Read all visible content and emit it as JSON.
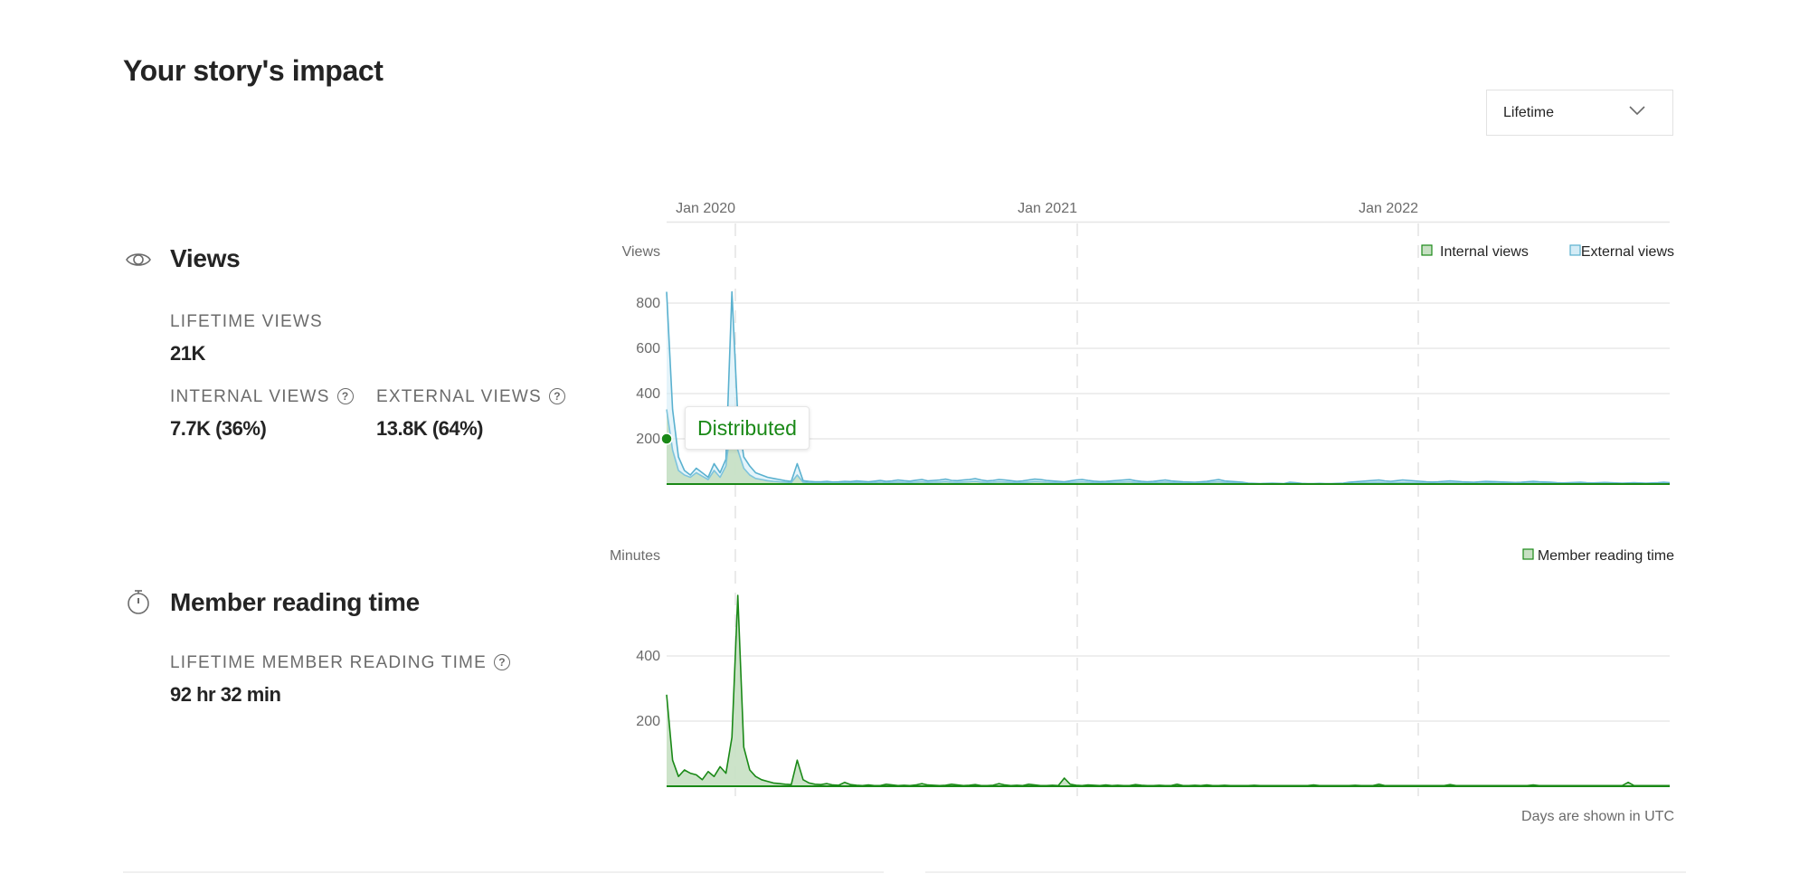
{
  "page": {
    "title": "Your story's impact",
    "period_dropdown": {
      "selected": "Lifetime"
    }
  },
  "views_section": {
    "title": "Views",
    "icon": "eye-icon",
    "lifetime_label": "Lifetime views",
    "lifetime_value": "21K",
    "internal_label": "Internal views",
    "internal_value": "7.7K (36%)",
    "external_label": "External views",
    "external_value": "13.8K (64%)",
    "help_glyph": "?"
  },
  "reading_section": {
    "title": "Member reading time",
    "icon": "stopwatch-icon",
    "lifetime_label": "Lifetime member reading time",
    "lifetime_value": "92 hr 32 min",
    "help_glyph": "?"
  },
  "tooltip": {
    "text": "Distributed"
  },
  "footnote": "Days are shown in UTC",
  "colors": {
    "internal": "#1a8917",
    "internal_fill": "#c7e0c3",
    "external": "#5ab1cf",
    "external_fill": "#d4ecf6",
    "grid": "#e8e8e8",
    "text_muted": "#6b6b6b"
  },
  "chart_data": [
    {
      "type": "area",
      "title": "Views",
      "ylabel": "Views",
      "x_tick_labels": [
        "Jan 2020",
        "Jan 2021",
        "Jan 2022"
      ],
      "x_range": [
        "Oct 2019",
        "Oct 2022"
      ],
      "yticks": [
        200,
        400,
        600,
        800
      ],
      "ylim": [
        0,
        860
      ],
      "grid": true,
      "legend": [
        "Internal views",
        "External views"
      ],
      "legend_position": "top-right",
      "annotation": {
        "label": "Distributed",
        "x_index": 0,
        "y": 200
      },
      "series": [
        {
          "name": "External views",
          "values": [
            850,
            330,
            120,
            60,
            40,
            70,
            50,
            30,
            90,
            50,
            110,
            850,
            300,
            120,
            80,
            50,
            40,
            30,
            25,
            20,
            15,
            12,
            90,
            15,
            12,
            10,
            10,
            12,
            9,
            10,
            12,
            11,
            14,
            12,
            10,
            13,
            16,
            12,
            14,
            18,
            15,
            13,
            17,
            20,
            14,
            16,
            18,
            22,
            16,
            15,
            18,
            20,
            24,
            18,
            14,
            16,
            20,
            18,
            15,
            12,
            14,
            18,
            22,
            20,
            16,
            14,
            12,
            10,
            14,
            18,
            20,
            16,
            13,
            11,
            12,
            14,
            16,
            18,
            20,
            15,
            12,
            10,
            12,
            15,
            18,
            14,
            12,
            10,
            9,
            8,
            10,
            12,
            16,
            20,
            14,
            12,
            10,
            8,
            4,
            3,
            2,
            3,
            4,
            3,
            2,
            8,
            6,
            3,
            2,
            2,
            3,
            2,
            2,
            3,
            4,
            8,
            10,
            12,
            14,
            16,
            18,
            14,
            12,
            15,
            18,
            16,
            14,
            12,
            10,
            9,
            10,
            12,
            14,
            12,
            10,
            9,
            8,
            10,
            12,
            11,
            10,
            9,
            8,
            7,
            8,
            10,
            12,
            10,
            9,
            8,
            6,
            5,
            6,
            7,
            8,
            6,
            5,
            6,
            7,
            6,
            5,
            4,
            5,
            6,
            5,
            4,
            5,
            6,
            8,
            6
          ]
        },
        {
          "name": "Internal views",
          "values": [
            330,
            150,
            60,
            40,
            30,
            50,
            35,
            20,
            60,
            30,
            80,
            300,
            150,
            70,
            40,
            25,
            20,
            15,
            12,
            10,
            8,
            6,
            40,
            8,
            6,
            5,
            5,
            6,
            5,
            5,
            6,
            5,
            7,
            6,
            5,
            6,
            8,
            6,
            7,
            9,
            7,
            6,
            8,
            10,
            7,
            8,
            9,
            11,
            8,
            7,
            9,
            10,
            12,
            9,
            7,
            8,
            10,
            9,
            7,
            6,
            7,
            9,
            11,
            10,
            8,
            7,
            6,
            5,
            7,
            9,
            10,
            8,
            6,
            5,
            6,
            7,
            8,
            9,
            10,
            7,
            6,
            5,
            6,
            7,
            9,
            7,
            6,
            5,
            4,
            4,
            5,
            6,
            8,
            10,
            7,
            6,
            5,
            4,
            2,
            1,
            1,
            1,
            2,
            1,
            1,
            3,
            2,
            1,
            1,
            1,
            1,
            1,
            1,
            1,
            2,
            3,
            4,
            5,
            6,
            7,
            8,
            6,
            5,
            6,
            7,
            7,
            6,
            5,
            4,
            4,
            4,
            5,
            6,
            5,
            4,
            4,
            3,
            4,
            5,
            5,
            4,
            4,
            3,
            3,
            3,
            4,
            5,
            4,
            4,
            3,
            2,
            2,
            2,
            3,
            3,
            2,
            2,
            2,
            3,
            2,
            2,
            2,
            2,
            2,
            2,
            2,
            2,
            2,
            3,
            2
          ]
        }
      ]
    },
    {
      "type": "area",
      "title": "Member reading time",
      "ylabel": "Minutes",
      "x_tick_labels": [
        "Jan 2020",
        "Jan 2021",
        "Jan 2022"
      ],
      "x_range": [
        "Oct 2019",
        "Oct 2022"
      ],
      "yticks": [
        200,
        400
      ],
      "ylim": [
        0,
        600
      ],
      "grid": true,
      "legend": [
        "Member reading time"
      ],
      "legend_position": "top-right",
      "series": [
        {
          "name": "Member reading time",
          "values": [
            281,
            80,
            30,
            50,
            40,
            35,
            20,
            45,
            30,
            60,
            40,
            150,
            586,
            120,
            50,
            30,
            20,
            15,
            10,
            8,
            6,
            5,
            80,
            20,
            10,
            6,
            5,
            8,
            4,
            3,
            12,
            5,
            3,
            2,
            4,
            2,
            2,
            6,
            4,
            2,
            3,
            2,
            4,
            8,
            4,
            3,
            2,
            3,
            6,
            4,
            2,
            3,
            5,
            2,
            2,
            3,
            8,
            4,
            2,
            3,
            2,
            6,
            4,
            2,
            2,
            3,
            2,
            25,
            6,
            3,
            2,
            4,
            3,
            2,
            4,
            2,
            3,
            2,
            2,
            5,
            3,
            2,
            2,
            3,
            2,
            2,
            6,
            2,
            2,
            3,
            2,
            4,
            2,
            2,
            3,
            2,
            2,
            2,
            2,
            3,
            2,
            2,
            2,
            2,
            2,
            2,
            2,
            2,
            2,
            4,
            2,
            2,
            2,
            2,
            2,
            2,
            3,
            2,
            2,
            2,
            6,
            2,
            2,
            2,
            2,
            2,
            2,
            2,
            2,
            2,
            2,
            2,
            5,
            2,
            2,
            2,
            2,
            2,
            2,
            2,
            2,
            2,
            2,
            2,
            2,
            2,
            4,
            2,
            2,
            2,
            2,
            2,
            2,
            2,
            2,
            2,
            2,
            2,
            2,
            2,
            2,
            2,
            12,
            2,
            2,
            2,
            2,
            2,
            2,
            2
          ]
        }
      ]
    }
  ]
}
